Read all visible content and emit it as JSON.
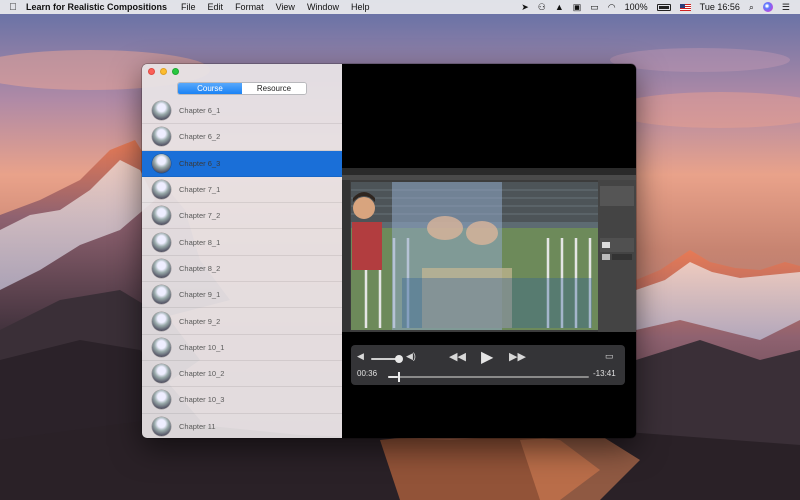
{
  "menubar": {
    "app_name": "Learn for Realistic Compositions",
    "menus": [
      "File",
      "Edit",
      "Format",
      "View",
      "Window",
      "Help"
    ],
    "battery_percent": "100%",
    "clock": "Tue 16:56",
    "status_icons": [
      "location-icon",
      "app-icon",
      "hat-icon",
      "lock-icon",
      "display-icon",
      "wifi-icon",
      "battery-icon",
      "flag-icon",
      "search-icon",
      "siri-icon",
      "list-icon"
    ]
  },
  "window": {
    "tabs": [
      {
        "label": "Course",
        "active": true
      },
      {
        "label": "Resource",
        "active": false
      }
    ],
    "chapters": [
      {
        "label": "Chapter 6_1",
        "selected": false
      },
      {
        "label": "Chapter 6_2",
        "selected": false
      },
      {
        "label": "Chapter 6_3",
        "selected": true
      },
      {
        "label": "Chapter 7_1",
        "selected": false
      },
      {
        "label": "Chapter 7_2",
        "selected": false
      },
      {
        "label": "Chapter 8_1",
        "selected": false
      },
      {
        "label": "Chapter 8_2",
        "selected": false
      },
      {
        "label": "Chapter 9_1",
        "selected": false
      },
      {
        "label": "Chapter 9_2",
        "selected": false
      },
      {
        "label": "Chapter 10_1",
        "selected": false
      },
      {
        "label": "Chapter 10_2",
        "selected": false
      },
      {
        "label": "Chapter 10_3",
        "selected": false
      },
      {
        "label": "Chapter 11",
        "selected": false
      }
    ]
  },
  "player": {
    "elapsed": "00:36",
    "remaining": "-13:41",
    "volume_fraction": 0.8,
    "progress_fraction": 0.05
  },
  "colors": {
    "accent": "#1a82f5",
    "selection": "#1a6fd8"
  }
}
